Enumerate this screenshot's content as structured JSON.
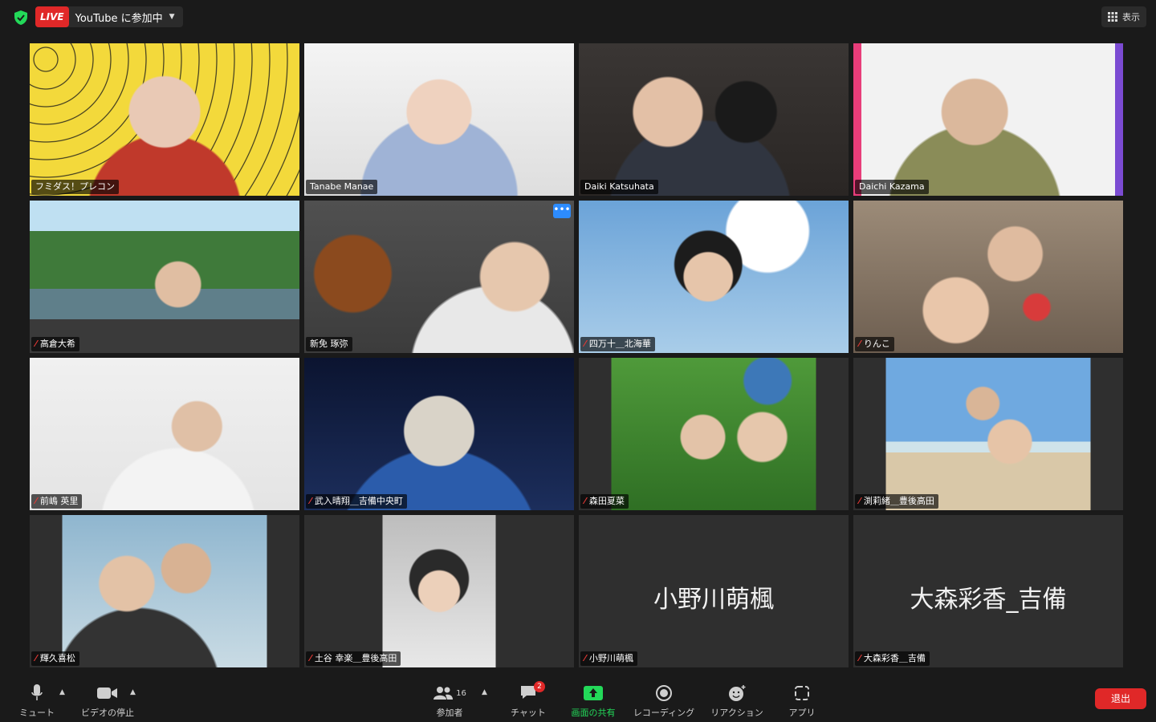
{
  "topbar": {
    "live_badge": "LIVE",
    "live_status": "YouTube に参加中",
    "view_label": "表示"
  },
  "tiles": [
    {
      "name": "フミダス！プレコン",
      "muted": false
    },
    {
      "name": "Tanabe Manae",
      "muted": false,
      "active": true
    },
    {
      "name": "Daiki Katsuhata",
      "muted": false
    },
    {
      "name": "Daichi Kazama",
      "muted": false
    },
    {
      "name": "高倉大希",
      "muted": true
    },
    {
      "name": "新免 琢弥",
      "muted": false
    },
    {
      "name": "四万十＿北海華",
      "muted": true
    },
    {
      "name": "りんこ",
      "muted": true
    },
    {
      "name": "前嶋 英里",
      "muted": true
    },
    {
      "name": "武入晴翔＿吉備中央町",
      "muted": true
    },
    {
      "name": "森田夏菜",
      "muted": true
    },
    {
      "name": "渕莉緒＿豊後高田",
      "muted": true
    },
    {
      "name": "輝久喜松",
      "muted": true
    },
    {
      "name": "土谷 幸楽＿豊後高田",
      "muted": true
    },
    {
      "name": "小野川萌楓",
      "muted": true,
      "big_name": "小野川萌楓"
    },
    {
      "name": "大森彩香＿吉備",
      "muted": true,
      "big_name": "大森彩香_吉備"
    }
  ],
  "tile_more": "•••",
  "toolbar": {
    "mute": "ミュート",
    "video": "ビデオの停止",
    "participants": "参加者",
    "participants_count": "16",
    "chat": "チャット",
    "chat_badge": "2",
    "share": "画面の共有",
    "record": "レコーディング",
    "reactions": "リアクション",
    "apps": "アプリ",
    "end": "退出"
  },
  "colors": {
    "live_red": "#e02828",
    "share_green": "#23d959",
    "active_speaker": "#c9e36a",
    "more_blue": "#2d8cff"
  }
}
